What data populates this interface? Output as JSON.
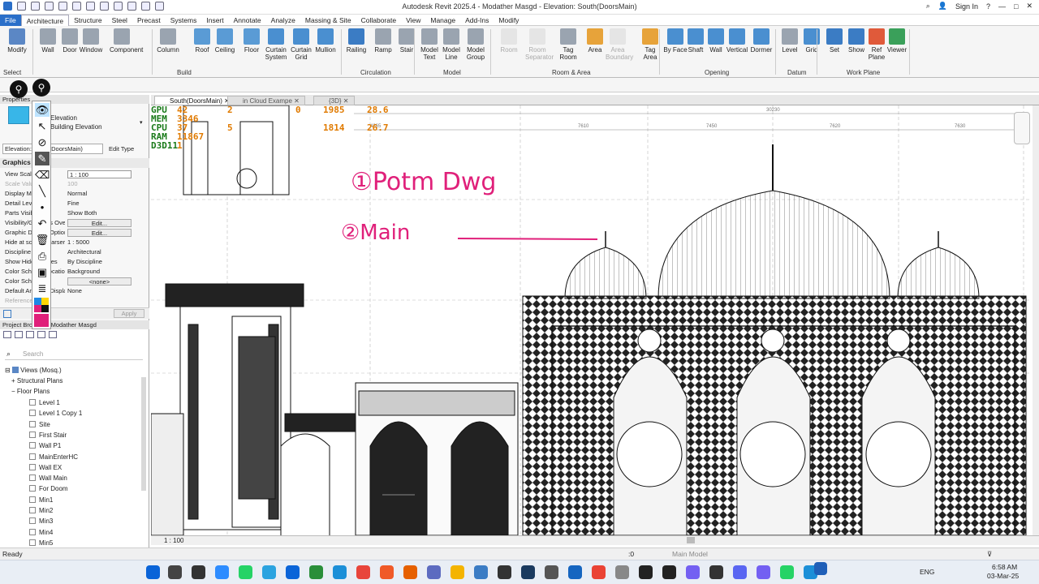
{
  "app": {
    "title": "Autodesk Revit 2025.4 - Modather Masgd - Elevation: South(DoorsMain)",
    "sign_in": "Sign In"
  },
  "menu_tabs": [
    "File",
    "Architecture",
    "Structure",
    "Steel",
    "Precast",
    "Systems",
    "Insert",
    "Annotate",
    "Analyze",
    "Massing & Site",
    "Collaborate",
    "View",
    "Manage",
    "Add-Ins",
    "Modify"
  ],
  "ribbon": {
    "buttons": [
      {
        "label": "Modify",
        "color": "#5b87c5"
      },
      {
        "label": "Wall",
        "color": "#9aa4b0"
      },
      {
        "label": "Door",
        "color": "#9aa4b0"
      },
      {
        "label": "Window",
        "color": "#9aa4b0"
      },
      {
        "label": "Component",
        "color": "#9aa4b0"
      },
      {
        "label": "Column",
        "color": "#9aa4b0"
      },
      {
        "label": "Roof",
        "color": "#5a9bd5"
      },
      {
        "label": "Ceiling",
        "color": "#5a9bd5"
      },
      {
        "label": "Floor",
        "color": "#5a9bd5"
      },
      {
        "label": "Curtain System",
        "color": "#4a8fd0"
      },
      {
        "label": "Curtain Grid",
        "color": "#4a8fd0"
      },
      {
        "label": "Mullion",
        "color": "#4a8fd0"
      },
      {
        "label": "Railing",
        "color": "#3b7cc4"
      },
      {
        "label": "Ramp",
        "color": "#9aa4b0"
      },
      {
        "label": "Stair",
        "color": "#9aa4b0"
      },
      {
        "label": "Model Text",
        "color": "#9aa4b0"
      },
      {
        "label": "Model Line",
        "color": "#9aa4b0"
      },
      {
        "label": "Model Group",
        "color": "#9aa4b0"
      },
      {
        "label": "Room",
        "color": "#c8c8c8"
      },
      {
        "label": "Room Separator",
        "color": "#c8c8c8"
      },
      {
        "label": "Tag Room",
        "color": "#9aa4b0"
      },
      {
        "label": "Area",
        "color": "#e7a33a"
      },
      {
        "label": "Area Boundary",
        "color": "#c8c8c8"
      },
      {
        "label": "Tag Area",
        "color": "#e7a33a"
      },
      {
        "label": "By Face",
        "color": "#4a8fd0"
      },
      {
        "label": "Shaft",
        "color": "#4a8fd0"
      },
      {
        "label": "Wall",
        "color": "#4a8fd0"
      },
      {
        "label": "Vertical",
        "color": "#4a8fd0"
      },
      {
        "label": "Dormer",
        "color": "#4a8fd0"
      },
      {
        "label": "Level",
        "color": "#9aa4b0"
      },
      {
        "label": "Grid",
        "color": "#4a8fd0"
      },
      {
        "label": "Set",
        "color": "#3b7cc4"
      },
      {
        "label": "Show",
        "color": "#3b7cc4"
      },
      {
        "label": "Ref Plane",
        "color": "#e05a3a"
      },
      {
        "label": "Viewer",
        "color": "#3aa05a"
      }
    ],
    "panels": [
      "Select",
      "Build",
      "Circulation",
      "Model",
      "Room & Area",
      "Opening",
      "Datum",
      "Work Plane"
    ]
  },
  "properties": {
    "header": "Properties",
    "type_line1": "Elevation",
    "type_line2": "Building Elevation",
    "selector": "Elevation: South(DoorsMain)",
    "edit_type": "Edit Type",
    "section": "Graphics",
    "rows": [
      {
        "k": "View Scale",
        "v": "1 : 100",
        "style": "box"
      },
      {
        "k": "Scale Value 1:",
        "v": "100",
        "style": "dim"
      },
      {
        "k": "Display Model",
        "v": "Normal",
        "style": ""
      },
      {
        "k": "Detail Level",
        "v": "Fine",
        "style": ""
      },
      {
        "k": "Parts Visibility",
        "v": "Show Both",
        "style": ""
      },
      {
        "k": "Visibility/Graphics Overrides",
        "v": "Edit...",
        "style": "btn"
      },
      {
        "k": "Graphic Display Options",
        "v": "Edit...",
        "style": "btn"
      },
      {
        "k": "Hide at scales coarser than",
        "v": "1 : 5000",
        "style": ""
      },
      {
        "k": "Discipline",
        "v": "Architectural",
        "style": ""
      },
      {
        "k": "Show Hidden Lines",
        "v": "By Discipline",
        "style": ""
      },
      {
        "k": "Color Scheme Location",
        "v": "Background",
        "style": ""
      },
      {
        "k": "Color Scheme",
        "v": "<none>",
        "style": "btn"
      },
      {
        "k": "Default Analysis Display Style",
        "v": "None",
        "style": ""
      },
      {
        "k": "Reference...",
        "v": "",
        "style": "dim"
      }
    ],
    "apply": "Apply"
  },
  "project_browser": {
    "header": "Project Browser - Modather Masgd",
    "search_placeholder": "Search",
    "root": "Views (Mosq.)",
    "groups": [
      "Structural Plans",
      "Floor Plans"
    ],
    "items": [
      "Level 1",
      "Level 1 Copy 1",
      "Site",
      "First Stair",
      "Wall P1",
      "MainEnterHC",
      "Wall EX",
      "Wall Main",
      "For Doom",
      "Min1",
      "Min2",
      "Min3",
      "Min4",
      "Min5"
    ]
  },
  "view_tabs": [
    {
      "label": "South(DoorsMain)",
      "active": true
    },
    {
      "label": "in Cloud Exampe",
      "active": false
    },
    {
      "label": "{3D}",
      "active": false
    }
  ],
  "hud": {
    "rows": [
      {
        "label": "GPU",
        "v1": "42",
        "v2": "2",
        "v3": "0",
        "v4": "1985",
        "v5": "28.6"
      },
      {
        "label": "MEM",
        "v1": "3346",
        "v2": "",
        "v3": "",
        "v4": "",
        "v5": ""
      },
      {
        "label": "CPU",
        "v1": "37",
        "v2": "5",
        "v3": "",
        "v4": "1814",
        "v5": "26.7"
      },
      {
        "label": "RAM",
        "v1": "11867",
        "v2": "",
        "v3": "",
        "v4": "",
        "v5": ""
      },
      {
        "label": "D3D11",
        "v1": "1",
        "v2": "",
        "v3": "",
        "v4": "",
        "v5": ""
      }
    ]
  },
  "drawing": {
    "dimensions": [
      "30230",
      "4265",
      "7610",
      "7450",
      "7620",
      "7630"
    ],
    "handwriting_1": "①Potm Dwg",
    "handwriting_2": "②Main",
    "annotation_color": "#e0207a"
  },
  "view_scale_status": "1 : 100",
  "status": {
    "left": "Ready",
    "model": "Main Model",
    "zero": ":0"
  },
  "taskbar": {
    "lang": "ENG",
    "time": "6:58 AM",
    "date": "03-Mar-25"
  }
}
